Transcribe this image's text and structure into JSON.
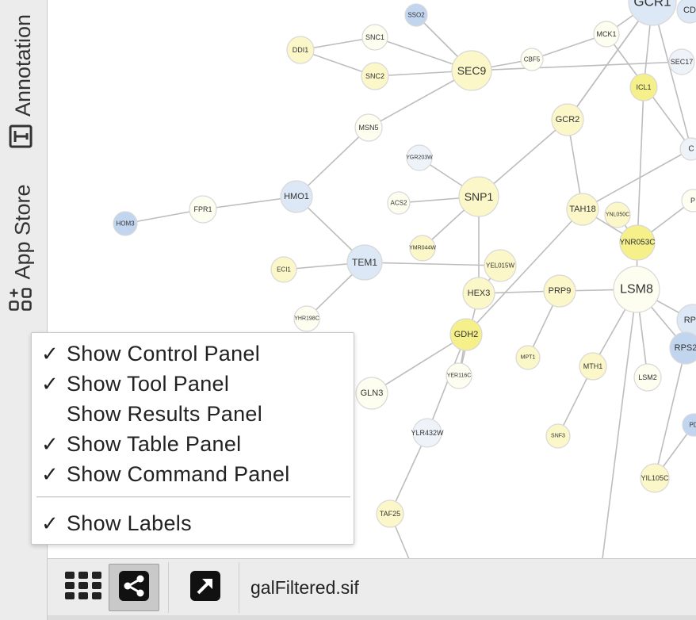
{
  "side_tabs": [
    {
      "id": "annotation",
      "label": "Annotation",
      "icon": "text-box-icon"
    },
    {
      "id": "app-store",
      "label": "App Store",
      "icon": "apps-add-icon"
    }
  ],
  "network": {
    "title": "galFiltered.sif",
    "colors": {
      "edge": "#bdbdbd",
      "node_stroke": "#d8d8d8",
      "yellow_pale": "#fdfdf0",
      "yellow_mid": "#fbf7c8",
      "yellow_strong": "#f5f08a",
      "blue_pale": "#eef3fa",
      "blue_mid": "#dce8f6",
      "blue_strong": "#c2d5ef"
    },
    "nodes": [
      {
        "id": "GCR1",
        "label": "GCR1"
      },
      {
        "id": "CD",
        "label": "CD"
      },
      {
        "id": "SSO2",
        "label": "SSO2"
      },
      {
        "id": "SNC1",
        "label": "SNC1"
      },
      {
        "id": "DDI1",
        "label": "DDI1"
      },
      {
        "id": "SNC2",
        "label": "SNC2"
      },
      {
        "id": "SEC9",
        "label": "SEC9"
      },
      {
        "id": "CBF5",
        "label": "CBF5"
      },
      {
        "id": "MCK1",
        "label": "MCK1"
      },
      {
        "id": "SEC17",
        "label": "SEC17"
      },
      {
        "id": "ICL1",
        "label": "ICL1"
      },
      {
        "id": "MSN5",
        "label": "MSN5"
      },
      {
        "id": "GCR2",
        "label": "GCR2"
      },
      {
        "id": "C",
        "label": "C"
      },
      {
        "id": "YGR203W",
        "label": "YGR203W"
      },
      {
        "id": "HMO1",
        "label": "HMO1"
      },
      {
        "id": "FPR1",
        "label": "FPR1"
      },
      {
        "id": "HOM3",
        "label": "HOM3"
      },
      {
        "id": "ACS2",
        "label": "ACS2"
      },
      {
        "id": "SNP1",
        "label": "SNP1"
      },
      {
        "id": "TAH18",
        "label": "TAH18"
      },
      {
        "id": "YNL050C",
        "label": "YNL050C"
      },
      {
        "id": "P",
        "label": "P"
      },
      {
        "id": "YMR044W",
        "label": "YMR044W"
      },
      {
        "id": "YNR053C",
        "label": "YNR053C"
      },
      {
        "id": "TEM1",
        "label": "TEM1"
      },
      {
        "id": "ECI1",
        "label": "ECI1"
      },
      {
        "id": "YEL015W",
        "label": "YEL015W"
      },
      {
        "id": "HEX3",
        "label": "HEX3"
      },
      {
        "id": "PRP9",
        "label": "PRP9"
      },
      {
        "id": "LSM8",
        "label": "LSM8"
      },
      {
        "id": "RPS",
        "label": "RPS"
      },
      {
        "id": "YHR198C",
        "label": "YHR198C"
      },
      {
        "id": "RPS2",
        "label": "RPS2"
      },
      {
        "id": "GDH2",
        "label": "GDH2"
      },
      {
        "id": "MPT1",
        "label": "MPT1"
      },
      {
        "id": "MTH1",
        "label": "MTH1"
      },
      {
        "id": "LSM2",
        "label": "LSM2"
      },
      {
        "id": "YER116C",
        "label": "YER116C"
      },
      {
        "id": "GLN3",
        "label": "GLN3"
      },
      {
        "id": "PD",
        "label": "PD"
      },
      {
        "id": "YLR432W",
        "label": "YLR432W"
      },
      {
        "id": "SNF3",
        "label": "SNF3"
      },
      {
        "id": "YIL105C",
        "label": "YIL105C"
      },
      {
        "id": "TAF25",
        "label": "TAF25"
      }
    ]
  },
  "context_menu": {
    "items": [
      {
        "label": "Show Control Panel",
        "checked": true
      },
      {
        "label": "Show Tool Panel",
        "checked": true
      },
      {
        "label": "Show Results Panel",
        "checked": false
      },
      {
        "label": "Show Table Panel",
        "checked": true
      },
      {
        "label": "Show Command Panel",
        "checked": true
      }
    ],
    "extra_items": [
      {
        "label": "Show Labels",
        "checked": true
      }
    ],
    "check_glyph": "✓"
  },
  "bottom_bar": {
    "buttons": [
      {
        "id": "grid",
        "icon": "grid-view-icon"
      },
      {
        "id": "network",
        "icon": "share-network-icon",
        "active": true
      },
      {
        "id": "detach",
        "icon": "external-arrow-icon"
      }
    ],
    "current_network": "galFiltered.sif"
  }
}
